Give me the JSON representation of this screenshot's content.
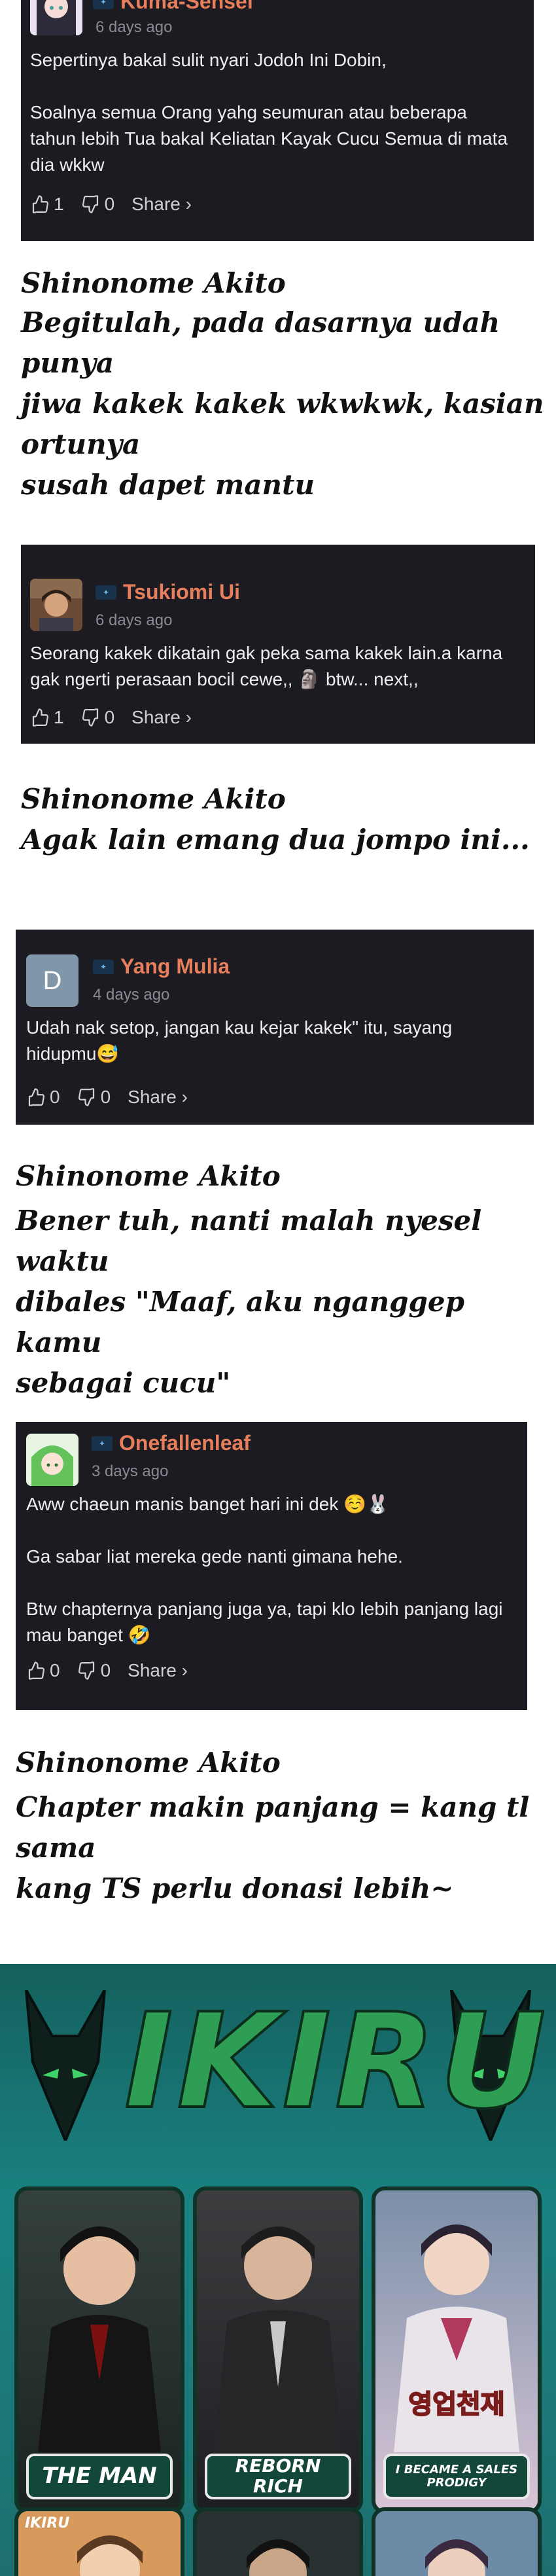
{
  "comments": [
    {
      "username": "Kuma-Sensei",
      "timestamp": "6 days ago",
      "paragraphs": [
        "Sepertinya bakal sulit nyari Jodoh Ini Dobin,",
        "Soalnya semua Orang yahg seumuran atau beberapa tahun lebih Tua bakal Keliatan Kayak Cucu Semua di mata dia wkkw"
      ],
      "likes": "1",
      "dislikes": "0",
      "share_label": "Share ›"
    },
    {
      "username": "Tsukiomi Ui",
      "timestamp": "6 days ago",
      "paragraphs": [
        "Seorang kakek dikatain gak peka sama kakek lain.a karna gak ngerti perasaan bocil cewe,, 🗿 btw... next,,"
      ],
      "likes": "1",
      "dislikes": "0",
      "share_label": "Share ›"
    },
    {
      "username": "Yang Mulia",
      "avatar_letter": "D",
      "timestamp": "4 days ago",
      "paragraphs": [
        "Udah nak setop, jangan kau kejar kakek\" itu, sayang hidupmu😅"
      ],
      "likes": "0",
      "dislikes": "0",
      "share_label": "Share ›"
    },
    {
      "username": "Onefallenleaf",
      "timestamp": "3 days ago",
      "paragraphs": [
        "Aww chaeun manis banget hari ini dek ☺️🐰",
        "Ga sabar liat mereka gede nanti gimana hehe.",
        "Btw chapternya panjang juga ya, tapi klo lebih panjang lagi mau banget 🤣"
      ],
      "likes": "0",
      "dislikes": "0",
      "share_label": "Share ›"
    }
  ],
  "replies": [
    {
      "author": "Shinonome Akito",
      "lines": [
        "Begitulah, pada dasarnya udah punya",
        "jiwa kakek kakek wkwkwk, kasian ortunya",
        "susah dapet mantu"
      ]
    },
    {
      "author": "Shinonome Akito",
      "lines": [
        "Agak lain emang dua jompo ini..."
      ]
    },
    {
      "author": "Shinonome Akito",
      "lines": [
        "Bener tuh, nanti malah nyesel waktu",
        "dibales \"Maaf, aku nganggep kamu",
        "sebagai cucu\""
      ]
    },
    {
      "author": "Shinonome Akito",
      "lines": [
        "Chapter makin panjang = kang tl sama",
        "kang TS perlu donasi lebih~"
      ]
    }
  ],
  "banner": {
    "title": "IKIRU",
    "mini_logo": "IKIRU",
    "manga": [
      {
        "label": "THE MAN"
      },
      {
        "label": "REBORN RICH"
      },
      {
        "label": "I BECAME A SALES PRODIGY"
      }
    ],
    "colors": {
      "background": "#1a8382",
      "title": "#2f9e55"
    }
  },
  "colors": {
    "card_bg": "#1c1b22",
    "username": "#e77f5d",
    "timestamp": "#8b8b93",
    "text": "#eeeeee"
  }
}
